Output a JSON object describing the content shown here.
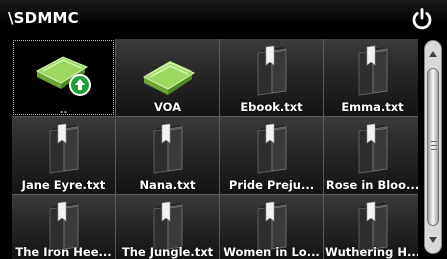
{
  "header": {
    "path": "\\SDMMC",
    "power_icon": "power-icon"
  },
  "tiles": [
    {
      "name": "tile-parent-folder",
      "icon": "folder-up-icon",
      "label": "..",
      "selected": true
    },
    {
      "name": "tile-folder-voa",
      "icon": "folder-icon",
      "label": "VOA"
    },
    {
      "name": "tile-file-ebook",
      "icon": "book-icon",
      "label": "Ebook.txt"
    },
    {
      "name": "tile-file-emma",
      "icon": "book-icon",
      "label": "Emma.txt"
    },
    {
      "name": "tile-file-jane-eyre",
      "icon": "book-icon",
      "label": "Jane Eyre.txt"
    },
    {
      "name": "tile-file-nana",
      "icon": "book-icon",
      "label": "Nana.txt"
    },
    {
      "name": "tile-file-pride",
      "icon": "book-icon",
      "label": "Pride  Preju..."
    },
    {
      "name": "tile-file-rose",
      "icon": "book-icon",
      "label": "Rose in Bloo..."
    },
    {
      "name": "tile-file-iron-heel",
      "icon": "book-icon",
      "label": "The Iron Hee..."
    },
    {
      "name": "tile-file-jungle",
      "icon": "book-icon",
      "label": "The Jungle.txt"
    },
    {
      "name": "tile-file-women",
      "icon": "book-icon",
      "label": "Women in Lo..."
    },
    {
      "name": "tile-file-wuthering",
      "icon": "book-icon",
      "label": "Wuthering H..."
    }
  ],
  "colors": {
    "folder": "#8fd14f",
    "up_badge": "#1f9e3a",
    "tile_border": "#5a5a5a"
  }
}
